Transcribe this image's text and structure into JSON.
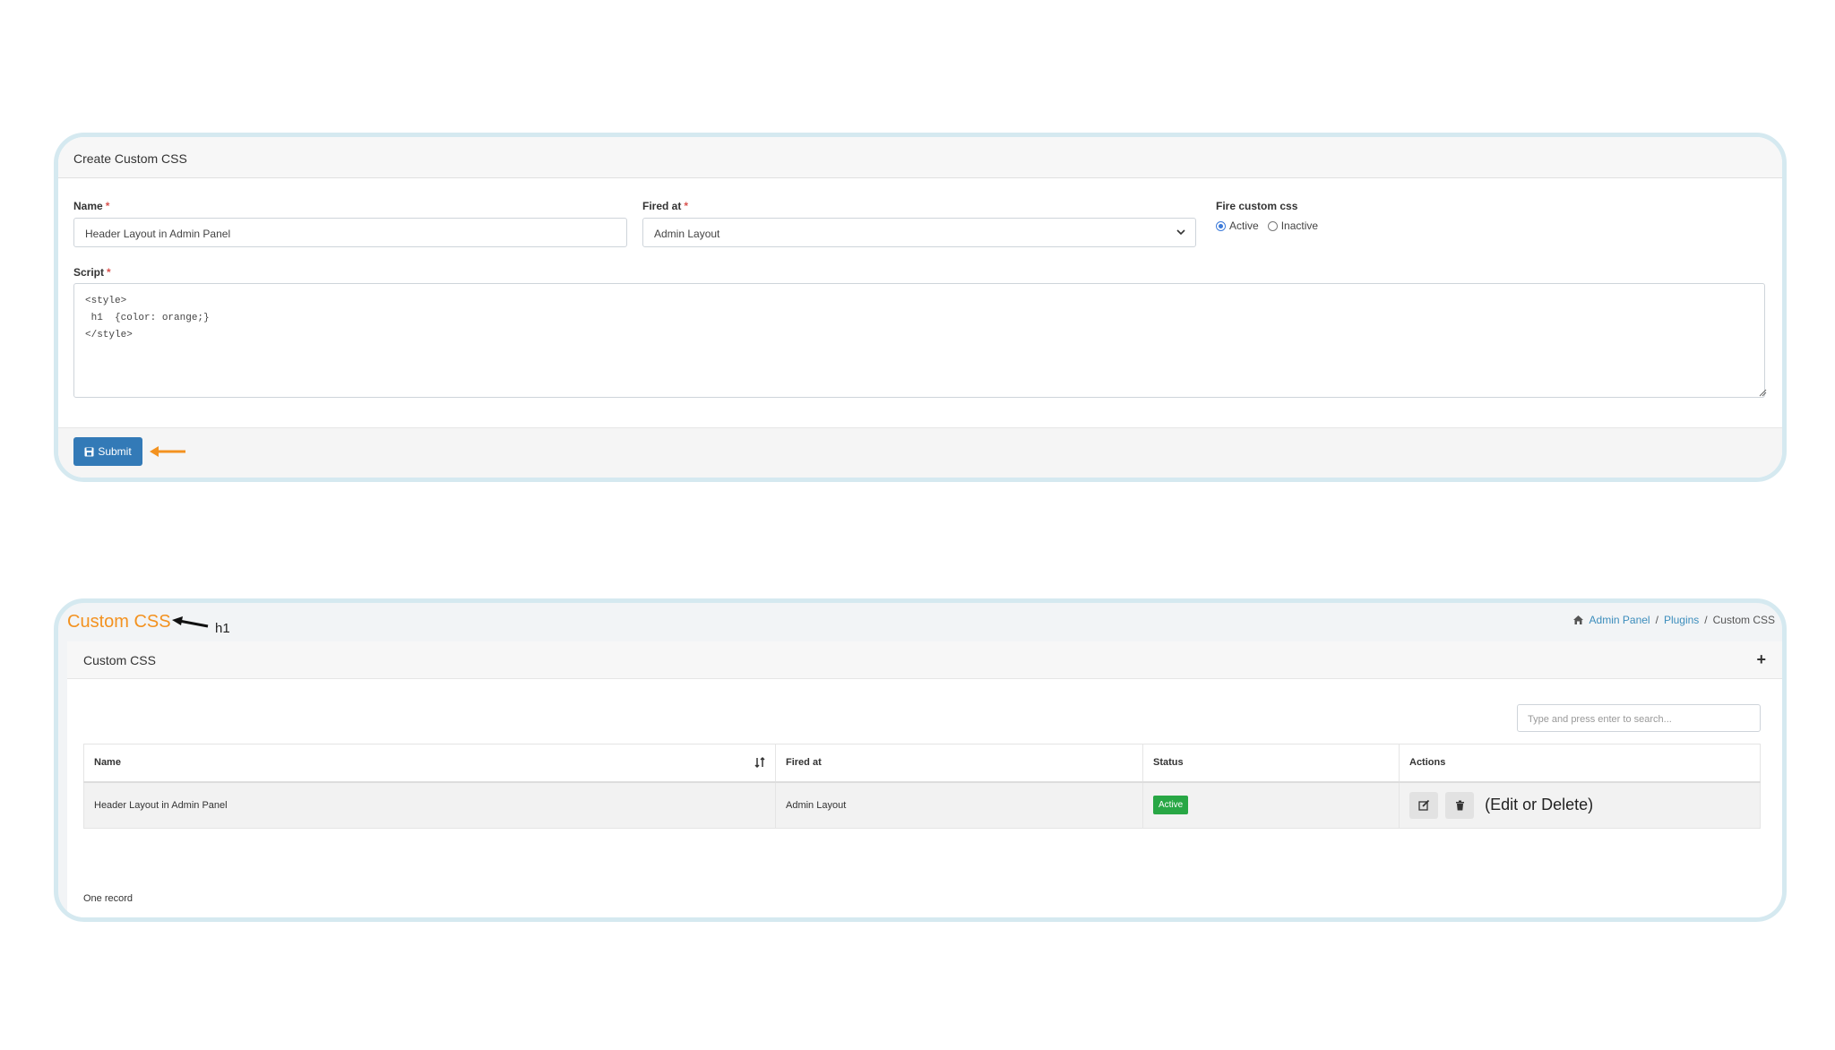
{
  "form": {
    "title": "Create Custom CSS",
    "name_label": "Name",
    "name_value": "Header Layout in Admin Panel",
    "fired_label": "Fired at",
    "fired_value": "Admin Layout",
    "fire_label": "Fire custom css",
    "radio_active": "Active",
    "radio_inactive": "Inactive",
    "radio_selected": "Active",
    "script_label": "Script",
    "script_value": "<style>\n h1  {color: orange;}\n</style>",
    "required_mark": "*",
    "submit_label": "Submit",
    "annotation_color": "#f39220"
  },
  "list": {
    "page_title": "Custom CSS",
    "title_annotation": "h1",
    "breadcrumb": [
      "Admin Panel",
      "Plugins",
      "Custom CSS"
    ],
    "card_title": "Custom CSS",
    "add_symbol": "+",
    "search_placeholder": "Type and press enter to search...",
    "columns": [
      "Name",
      "Fired at",
      "Status",
      "Actions"
    ],
    "rows": [
      {
        "name": "Header Layout in Admin Panel",
        "fired_at": "Admin Layout",
        "status": "Active"
      }
    ],
    "actions_note": "(Edit or Delete)",
    "record_count": "One record",
    "status_color": "#28a745",
    "title_color": "#f39220"
  }
}
